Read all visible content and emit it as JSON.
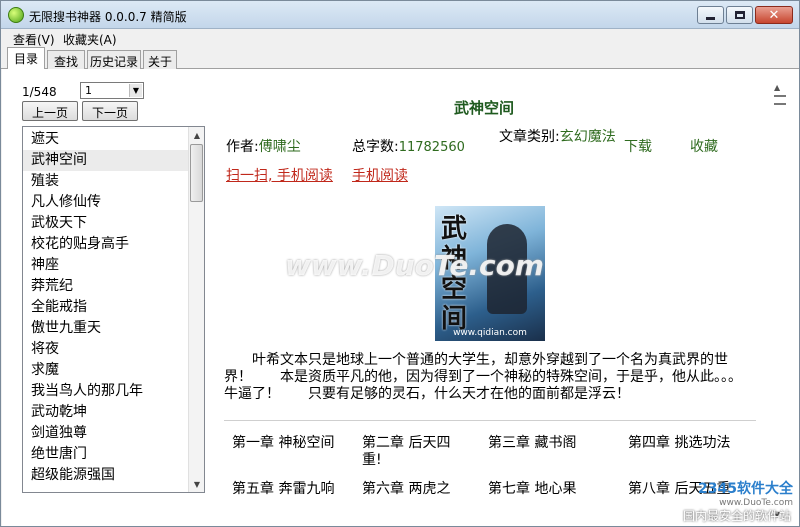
{
  "window": {
    "title": "无限搜书神器 0.0.0.7 精简版"
  },
  "menu": [
    "查看(V)",
    "收藏夹(A)"
  ],
  "tabs": [
    "目录",
    "查找",
    "历史记录",
    "关于"
  ],
  "pager": {
    "text": "1/548",
    "select_value": "1",
    "prev_label": "上一页",
    "next_label": "下一页"
  },
  "book_list": [
    "遮天",
    "武神空间",
    "殖装",
    "凡人修仙传",
    "武极天下",
    "校花的贴身高手",
    "神座",
    "莽荒纪",
    "全能戒指",
    "傲世九重天",
    "将夜",
    "求魔",
    "我当鸟人的那几年",
    "武动乾坤",
    "剑道独尊",
    "绝世唐门",
    "超级能源强国"
  ],
  "selected_book": "武神空间",
  "detail": {
    "title": "武神空间",
    "author_label": "作者:",
    "author": "傅啸尘",
    "words_label": "总字数:",
    "words": "11782560",
    "category_label": "文章类别:",
    "category": "玄幻魔法",
    "download": "下载",
    "favorite": "收藏",
    "scan_link": "扫一扫, 手机阅读",
    "mobile_link": "手机阅读",
    "cover_title": "武神空间",
    "cover_site": "www.qidian.com",
    "description": "叶希文本只是地球上一个普通的大学生，却意外穿越到了一个名为真武界的世界！　　本是资质平凡的他，因为得到了一个神秘的特殊空间，于是乎，他从此。。。牛逼了！　　只要有足够的灵石，什么天才在他的面前都是浮云！"
  },
  "chapters": [
    "第一章 神秘空间",
    "第二章 后天四重!",
    "第三章 藏书阁",
    "第四章 挑选功法",
    "第五章 奔雷九响",
    "第六章 两虎之",
    "第七章 地心果",
    "第八章 后天五重"
  ],
  "watermark": "www.DuoTe.com",
  "corner": {
    "brand": "2345软件大全",
    "url": "www.DuoTe.com",
    "slogan": "国内最安全的软件站"
  }
}
